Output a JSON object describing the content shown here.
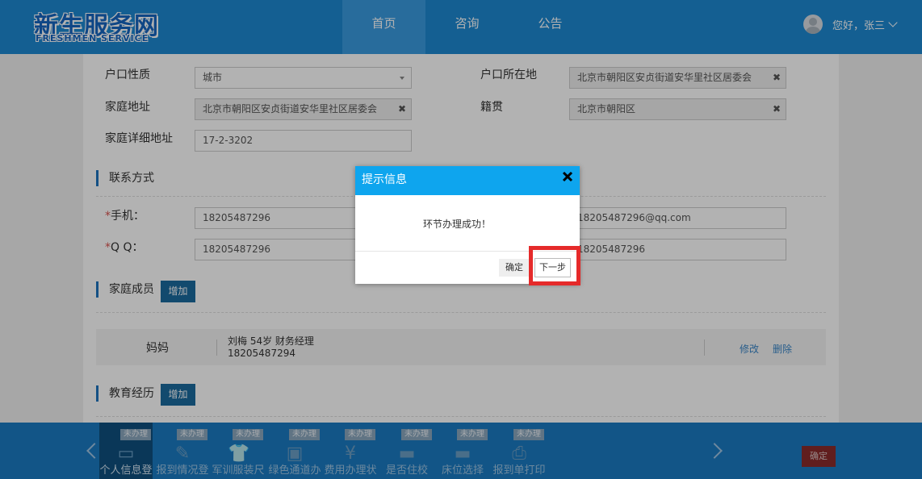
{
  "header": {
    "logo_main": "新生服务网",
    "logo_sub": "FRESHMEN SERVICE",
    "nav": [
      "首页",
      "咨询",
      "公告"
    ],
    "greeting": "您好，张三"
  },
  "form": {
    "hukou_type_label": "户口性质",
    "hukou_type_value": "城市",
    "hukou_loc_label": "户口所在地",
    "hukou_loc_value": "北京市朝阳区安贞街道安华里社区居委会",
    "home_addr_label": "家庭地址",
    "home_addr_value": "北京市朝阳区安贞街道安华里社区居委会",
    "native_label": "籍贯",
    "native_value": "北京市朝阳区",
    "detail_addr_label": "家庭详细地址",
    "detail_addr_value": "17-2-3202"
  },
  "contact": {
    "title": "联系方式",
    "phone_label": "手机：",
    "phone_value": "18205487296",
    "email_value": "18205487296@qq.com",
    "qq_label": "Q Q：",
    "qq_value": "18205487296",
    "qq_right_value": "18205487296"
  },
  "family": {
    "title": "家庭成员",
    "add_label": "增加",
    "members": [
      {
        "relation": "妈妈",
        "info": "刘梅  54岁  财务经理",
        "phone": "18205487294",
        "edit": "修改",
        "delete": "删除"
      }
    ]
  },
  "education": {
    "title": "教育经历",
    "add_label": "增加"
  },
  "modal": {
    "title": "提示信息",
    "message": "环节办理成功！",
    "ok_label": "确定",
    "next_label": "下一步"
  },
  "steps": [
    {
      "badge": "未办理",
      "label": "个人信息登",
      "icon": "id-card-icon",
      "glyph": "▭"
    },
    {
      "badge": "未办理",
      "label": "报到情况登",
      "icon": "edit-icon",
      "glyph": "✎"
    },
    {
      "badge": "未办理",
      "label": "军训服装尺",
      "icon": "shirt-icon",
      "glyph": "👕"
    },
    {
      "badge": "未办理",
      "label": "绿色通道办",
      "icon": "contact-card-icon",
      "glyph": "▣"
    },
    {
      "badge": "未办理",
      "label": "费用办理状",
      "icon": "money-icon",
      "glyph": "¥"
    },
    {
      "badge": "未办理",
      "label": "是否住校",
      "icon": "bed-icon",
      "glyph": "▬"
    },
    {
      "badge": "未办理",
      "label": "床位选择",
      "icon": "bed-select-icon",
      "glyph": "▬"
    },
    {
      "badge": "未办理",
      "label": "报到单打印",
      "icon": "printer-icon",
      "glyph": "⎙"
    }
  ],
  "bottom": {
    "confirm_label": "确定"
  },
  "colors": {
    "header_bg": "#1e88d2",
    "modal_head": "#0ea5ee",
    "highlight": "#e52a2a",
    "bottom_bar": "#1b7ac2"
  }
}
